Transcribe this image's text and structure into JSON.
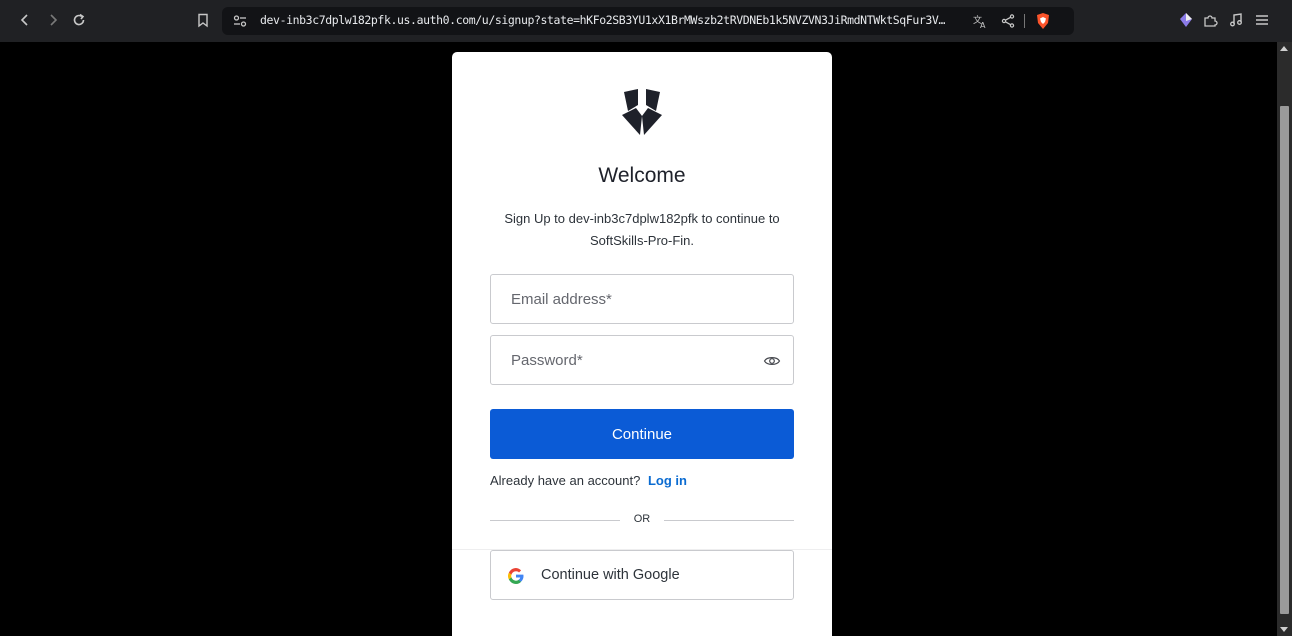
{
  "browser": {
    "url": "dev-inb3c7dplw182pfk.us.auth0.com/u/signup?state=hKFo2SB3YU1xX1BrMWszb2tRVDNEb1k5NVZVN3JiRmdNTWktSqFur3V…"
  },
  "login_card": {
    "title": "Welcome",
    "subtitle": "Sign Up to dev-inb3c7dplw182pfk to continue to SoftSkills-Pro-Fin.",
    "email_placeholder": "Email address*",
    "password_placeholder": "Password*",
    "continue_label": "Continue",
    "already_text": "Already have an account?",
    "login_link": "Log in",
    "or_text": "OR",
    "google_label": "Continue with Google"
  },
  "colors": {
    "primary_button": "#0b5bd6",
    "link": "#0a6bd1",
    "page_background": "#000000",
    "toolbar_background": "#202124"
  },
  "icons": [
    "back-icon",
    "forward-icon",
    "reload-icon",
    "bookmark-icon",
    "site-settings-icon",
    "translate-icon",
    "share-icon",
    "brave-shields-icon",
    "wallet-icon",
    "extensions-icon",
    "media-icon",
    "menu-icon",
    "shield-logo-icon",
    "eye-icon",
    "google-icon"
  ]
}
